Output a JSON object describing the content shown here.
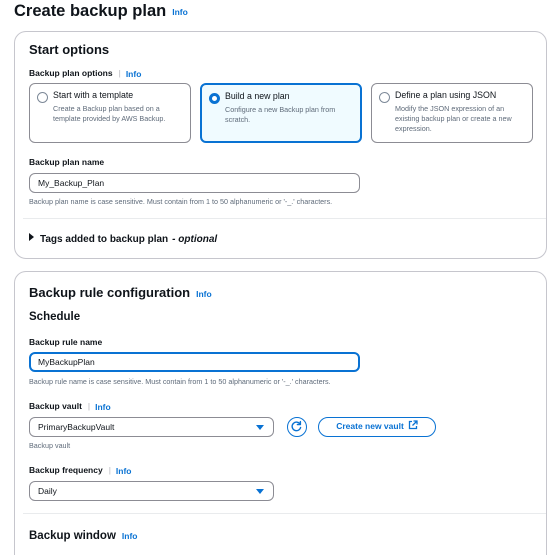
{
  "page": {
    "title": "Create backup plan",
    "info": "Info"
  },
  "start_options": {
    "heading": "Start options",
    "plan_options_label": "Backup plan options",
    "plan_options_info": "Info",
    "options": [
      {
        "title": "Start with a template",
        "description": "Create a Backup plan based on a template provided by AWS Backup.",
        "selected": false
      },
      {
        "title": "Build a new plan",
        "description": "Configure a new Backup plan from scratch.",
        "selected": true
      },
      {
        "title": "Define a plan using JSON",
        "description": "Modify the JSON expression of an existing backup plan or create a new expression.",
        "selected": false
      }
    ],
    "plan_name_label": "Backup plan name",
    "plan_name_value": "My_Backup_Plan",
    "plan_name_help": "Backup plan name is case sensitive. Must contain from 1 to 50 alphanumeric or '-_.' characters.",
    "tags_label": "Tags added to backup plan",
    "tags_optional": "- optional"
  },
  "rule_config": {
    "heading": "Backup rule configuration",
    "info": "Info",
    "schedule_heading": "Schedule",
    "rule_name_label": "Backup rule name",
    "rule_name_value": "MyBackupPlan",
    "rule_name_help": "Backup rule name is case sensitive. Must contain from 1 to 50 alphanumeric or '-_.' characters.",
    "vault_label": "Backup vault",
    "vault_info": "Info",
    "vault_value": "PrimaryBackupVault",
    "vault_help": "Backup vault",
    "create_vault_label": "Create new vault",
    "frequency_label": "Backup frequency",
    "frequency_info": "Info",
    "frequency_value": "Daily",
    "window_heading": "Backup window",
    "window_info": "Info"
  },
  "colors": {
    "accent": "#0972d3",
    "selected_bg": "#f0fbff",
    "border": "#c6c6cd"
  }
}
